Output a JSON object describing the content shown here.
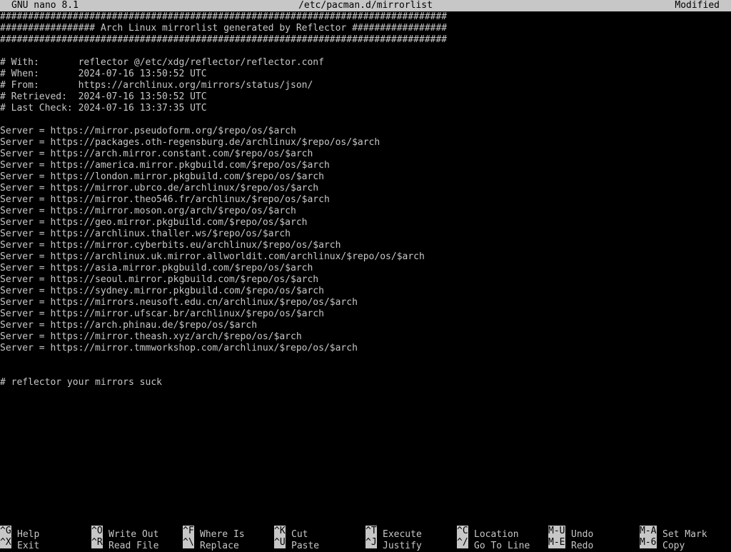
{
  "titlebar": {
    "app": "GNU nano 8.1",
    "filename": "/etc/pacman.d/mirrorlist",
    "status": "Modified"
  },
  "editor": {
    "lines": [
      "################################################################################",
      "################# Arch Linux mirrorlist generated by Reflector #################",
      "################################################################################",
      "",
      "# With:       reflector @/etc/xdg/reflector/reflector.conf",
      "# When:       2024-07-16 13:50:52 UTC",
      "# From:       https://archlinux.org/mirrors/status/json/",
      "# Retrieved:  2024-07-16 13:50:52 UTC",
      "# Last Check: 2024-07-16 13:37:35 UTC",
      "",
      "Server = https://mirror.pseudoform.org/$repo/os/$arch",
      "Server = https://packages.oth-regensburg.de/archlinux/$repo/os/$arch",
      "Server = https://arch.mirror.constant.com/$repo/os/$arch",
      "Server = https://america.mirror.pkgbuild.com/$repo/os/$arch",
      "Server = https://london.mirror.pkgbuild.com/$repo/os/$arch",
      "Server = https://mirror.ubrco.de/archlinux/$repo/os/$arch",
      "Server = https://mirror.theo546.fr/archlinux/$repo/os/$arch",
      "Server = https://mirror.moson.org/arch/$repo/os/$arch",
      "Server = https://geo.mirror.pkgbuild.com/$repo/os/$arch",
      "Server = https://archlinux.thaller.ws/$repo/os/$arch",
      "Server = https://mirror.cyberbits.eu/archlinux/$repo/os/$arch",
      "Server = https://archlinux.uk.mirror.allworldit.com/archlinux/$repo/os/$arch",
      "Server = https://asia.mirror.pkgbuild.com/$repo/os/$arch",
      "Server = https://seoul.mirror.pkgbuild.com/$repo/os/$arch",
      "Server = https://sydney.mirror.pkgbuild.com/$repo/os/$arch",
      "Server = https://mirrors.neusoft.edu.cn/archlinux/$repo/os/$arch",
      "Server = https://mirror.ufscar.br/archlinux/$repo/os/$arch",
      "Server = https://arch.phinau.de/$repo/os/$arch",
      "Server = https://mirror.theash.xyz/arch/$repo/os/$arch",
      "Server = https://mirror.tmmworkshop.com/archlinux/$repo/os/$arch",
      "",
      "",
      "# reflector your mirrors suck"
    ]
  },
  "shortcuts": {
    "row1": [
      {
        "key": "^G",
        "label": "Help"
      },
      {
        "key": "^O",
        "label": "Write Out"
      },
      {
        "key": "^F",
        "label": "Where Is"
      },
      {
        "key": "^K",
        "label": "Cut"
      },
      {
        "key": "^T",
        "label": "Execute"
      },
      {
        "key": "^C",
        "label": "Location"
      },
      {
        "key": "M-U",
        "label": "Undo"
      },
      {
        "key": "M-A",
        "label": "Set Mark"
      }
    ],
    "row2": [
      {
        "key": "^X",
        "label": "Exit"
      },
      {
        "key": "^R",
        "label": "Read File"
      },
      {
        "key": "^\\",
        "label": "Replace"
      },
      {
        "key": "^U",
        "label": "Paste"
      },
      {
        "key": "^J",
        "label": "Justify"
      },
      {
        "key": "^/",
        "label": "Go To Line"
      },
      {
        "key": "M-E",
        "label": "Redo"
      },
      {
        "key": "M-6",
        "label": "Copy"
      }
    ]
  },
  "colors": {
    "background": "#000000",
    "foreground": "#c7c7c7",
    "inverse_bg": "#c7c7c7",
    "inverse_fg": "#000000"
  }
}
